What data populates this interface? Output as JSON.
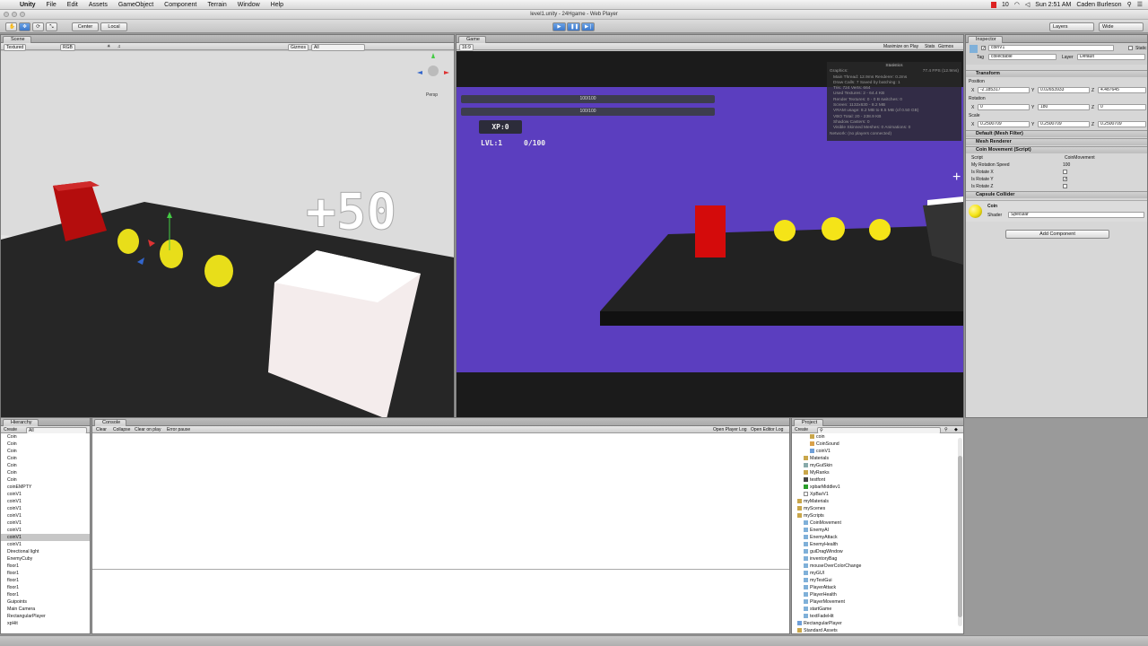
{
  "menubar": {
    "items": [
      "Unity",
      "File",
      "Edit",
      "Assets",
      "GameObject",
      "Component",
      "Terrain",
      "Window",
      "Help"
    ],
    "status": {
      "battery": "10",
      "clock": "Sun 2:51 AM",
      "user": "Caden Burleson"
    }
  },
  "window": {
    "title": "level1.unity - 24Hgame - Web Player"
  },
  "toolbar": {
    "center": "Center",
    "local": "Local",
    "layers": "Layers",
    "layout": "Wide"
  },
  "scene": {
    "tab": "Scene",
    "shading": "Textured",
    "render": "RGB",
    "gizmos": "Gizmos",
    "search_placeholder": "All",
    "persp": "Persp",
    "popup_text": "+50"
  },
  "game": {
    "tab": "Game",
    "aspect": "16:9",
    "maximize": "Maximize on Play",
    "stats_btn": "Stats",
    "gizmos": "Gizmos",
    "bar1": "100/100",
    "bar2": "100/100",
    "xp": "XP:0",
    "lvl": "LVL:1",
    "progress": "0/100",
    "statistics": {
      "title": "Statistics",
      "graphics_label": "Graphics:",
      "fps": "77.4 FPS (12.9ms)",
      "lines": [
        "Main Thread: 12.9ms  Renderer: 0.2ms",
        "Draw Calls: 7  Saved by batching: 1",
        "Tris: 724  Verts: 664",
        "Used Textures: 2 - 64.4 KB",
        "Render Textures: 0 - 0 B  switches: 0",
        "Screen: 1132x630 - 8.2 MB",
        "VRAM usage: 8.2 MB to 8.5 MB (of 0.50 GB)",
        "VBO Total: 20 - 238.9 KB",
        "Shadow Casters: 0",
        "Visible Skinned Meshes: 0    Animations: 0"
      ],
      "network": "Network: (no players connected)"
    }
  },
  "hierarchy": {
    "tab": "Hierarchy",
    "create": "Create",
    "search_placeholder": "All",
    "items": [
      "Coin",
      "Coin",
      "Coin",
      "Coin",
      "Coin",
      "Coin",
      "Coin",
      "coinEMPTY",
      "coinV1",
      "coinV1",
      "coinV1",
      "coinV1",
      "coinV1",
      "coinV1",
      "coinV1",
      "coinV1",
      "Directional light",
      "EnemyCuby",
      "floor1",
      "floor1",
      "floor1",
      "floor1",
      "floor1",
      "Guipoints",
      "Main Camera",
      "RectangularPlayer",
      "xpHit"
    ],
    "selected_index": 14
  },
  "console": {
    "tab": "Console",
    "buttons": [
      "Clear",
      "Collapse",
      "Clear on play",
      "Error pause"
    ],
    "right_buttons": [
      "Open Player Log",
      "Open Editor Log"
    ]
  },
  "project": {
    "tab": "Project",
    "create": "Create",
    "items": [
      {
        "label": "coin",
        "kind": "folder",
        "indent": 2
      },
      {
        "label": "CoinSound",
        "kind": "audio",
        "indent": 2
      },
      {
        "label": "coinV1",
        "kind": "prefab",
        "indent": 2
      },
      {
        "label": "Materials",
        "kind": "folder",
        "indent": 1
      },
      {
        "label": "myGuiSkin",
        "kind": "skin",
        "indent": 1
      },
      {
        "label": "MyRanks",
        "kind": "folder",
        "indent": 1
      },
      {
        "label": "testfont",
        "kind": "font",
        "indent": 1
      },
      {
        "label": "xpbarMiddlev1",
        "kind": "texture",
        "indent": 1
      },
      {
        "label": "XpBarV1",
        "kind": "texture-white",
        "indent": 1
      },
      {
        "label": "myMaterials",
        "kind": "folder",
        "indent": 0
      },
      {
        "label": "myScenes",
        "kind": "folder",
        "indent": 0
      },
      {
        "label": "myScripts",
        "kind": "folder",
        "indent": 0
      },
      {
        "label": "CoinMovement",
        "kind": "script",
        "indent": 1
      },
      {
        "label": "EnemyAI",
        "kind": "script",
        "indent": 1
      },
      {
        "label": "EnemyAttack",
        "kind": "script",
        "indent": 1
      },
      {
        "label": "EnemyHealth",
        "kind": "script",
        "indent": 1
      },
      {
        "label": "guiDragWindow",
        "kind": "script",
        "indent": 1
      },
      {
        "label": "inventoryBag",
        "kind": "script",
        "indent": 1
      },
      {
        "label": "mouseOverColorChange",
        "kind": "script",
        "indent": 1
      },
      {
        "label": "myGUI",
        "kind": "script",
        "indent": 1
      },
      {
        "label": "myTestGui",
        "kind": "script",
        "indent": 1
      },
      {
        "label": "PlayerAttack",
        "kind": "script",
        "indent": 1
      },
      {
        "label": "PlayerHealth",
        "kind": "script",
        "indent": 1
      },
      {
        "label": "PlayerMovement",
        "kind": "script",
        "indent": 1
      },
      {
        "label": "startGame",
        "kind": "script",
        "indent": 1
      },
      {
        "label": "textFadeHit",
        "kind": "script",
        "indent": 1
      },
      {
        "label": "RectangularPlayer",
        "kind": "prefab",
        "indent": 0
      },
      {
        "label": "Standard Assets",
        "kind": "folder",
        "indent": 0
      }
    ]
  },
  "inspector": {
    "tab": "Inspector",
    "object_name": "coinV1",
    "static_label": "Static",
    "tag_label": "Tag",
    "tag_value": "collectable",
    "layer_label": "Layer",
    "layer_value": "Default",
    "transform": {
      "title": "Transform",
      "position_label": "Position",
      "position": {
        "x": "-2.185317",
        "y": "0.02653933",
        "z": "4.487645"
      },
      "rotation_label": "Rotation",
      "rotation": {
        "x": "0",
        "y": "180",
        "z": "0"
      },
      "scale_label": "Scale",
      "scale": {
        "x": "0.2500709",
        "y": "0.2500709",
        "z": "0.2500709"
      }
    },
    "components": [
      "Default (Mesh Filter)",
      "Mesh Renderer",
      "Coin Movement (Script)"
    ],
    "coin_movement": {
      "script_label": "Script",
      "script_value": "CoinMovement",
      "speed_label": "My Rotation Speed",
      "speed_value": "100",
      "rotate_x_label": "Is Rotate X",
      "rotate_y_label": "Is Rotate Y",
      "rotate_z_label": "Is Rotate Z",
      "rotate_x": false,
      "rotate_y": true,
      "rotate_z": false
    },
    "capsule_collider": "Capsule Collider",
    "material": {
      "name": "Coin",
      "shader_label": "Shader",
      "shader_value": "Specular"
    },
    "add_component": "Add Component"
  },
  "colors": {
    "game_bg": "#5b3ebf",
    "coin": "#f5e418",
    "enemy": "#d40b0b",
    "selection": "#3d78c9"
  }
}
